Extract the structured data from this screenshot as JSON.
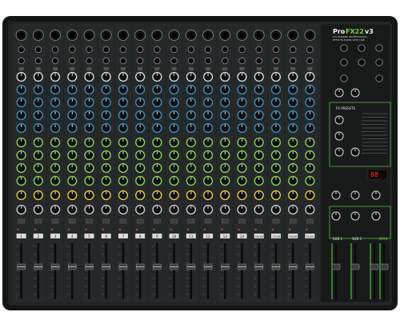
{
  "product": {
    "brand_prefix": "Pro",
    "brand_model": "FX22",
    "brand_version": "v3",
    "subtitle_1": "22-CHANNEL PROFESSIONAL",
    "subtitle_2": "EFFECTS MIXER WITH USB"
  },
  "channels": {
    "count": 16,
    "mono_labels": [
      "1",
      "2",
      "3",
      "4",
      "5",
      "6",
      "7",
      "8",
      "9",
      "10",
      "11",
      "12",
      "13",
      "14"
    ],
    "stereo_labels": [
      "15/16",
      "17/18",
      "19/20",
      "21/22"
    ],
    "knob_rows": [
      "aux 1",
      "aux 2",
      "aux 3",
      "aux 4",
      "eq high",
      "eq mid",
      "eq mid freq",
      "eq low",
      "fx",
      "pan"
    ],
    "knob_colors": {
      "gain": "#d9d9d9",
      "aux": "#3c8fbf",
      "eq": "#8bd15b",
      "fx": "#e7c94a",
      "pan": "#cccccc"
    }
  },
  "fx_section": {
    "title": "FX PRESETS",
    "display_value": "88",
    "accent": "#63c23a"
  },
  "master": {
    "label": "MAIN",
    "sub_labels": [
      "SUB 1",
      "SUB 2"
    ]
  },
  "colors": {
    "body": "#1b1d1d",
    "panel": "#2b2e2e",
    "frame": "#0f1010",
    "green_accent": "#4fbf3a"
  }
}
